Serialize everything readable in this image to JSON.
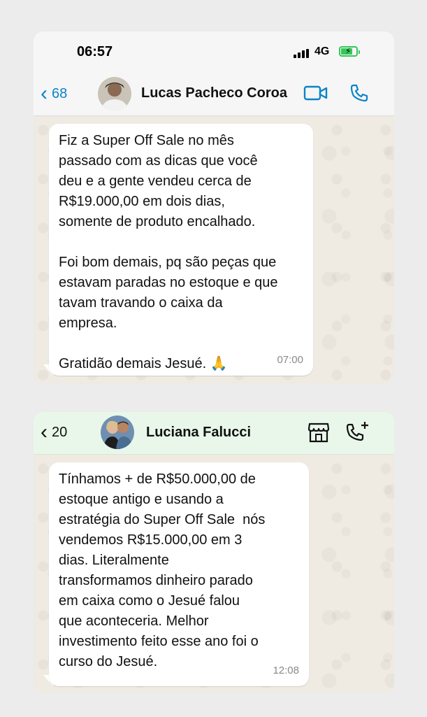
{
  "card1": {
    "status_bar": {
      "time": "06:57",
      "network": "4G"
    },
    "header": {
      "back_count": "68",
      "contact_name": "Lucas Pacheco Coroa",
      "icons": [
        "chevron-left-icon",
        "video-call-icon",
        "phone-icon"
      ]
    },
    "message": {
      "text": "Fiz a Super Off Sale no mês\npassado com as dicas que você\ndeu e a gente vendeu cerca de\nR$19.000,00 em dois dias,\nsomente de produto encalhado.\n\nFoi bom demais, pq são peças que\nestavam paradas no estoque e que\ntavam travando o caixa da\nempresa.\n\nGratidão demais Jesué. 🙏",
      "time": "07:00"
    }
  },
  "card2": {
    "header": {
      "back_count": "20",
      "contact_name": "Luciana Falucci",
      "icons": [
        "chevron-left-icon",
        "store-icon",
        "add-call-icon"
      ]
    },
    "message": {
      "text": "Tínhamos + de R$50.000,00 de\nestoque antigo e usando a\nestratégia do Super Off Sale  nós\nvendemos R$15.000,00 em 3\ndias. Literalmente\ntransformamos dinheiro parado\nem caixa como o Jesué falou\nque aconteceria. Melhor\ninvestimento feito esse ano foi o\ncurso do Jesué.",
      "time": "12:08"
    }
  },
  "colors": {
    "ios_blue": "#0a84c7",
    "battery_green": "#34c759",
    "business_header": "#e9f7ea",
    "chat_wallpaper": "#efeae2",
    "bubble": "#ffffff"
  }
}
